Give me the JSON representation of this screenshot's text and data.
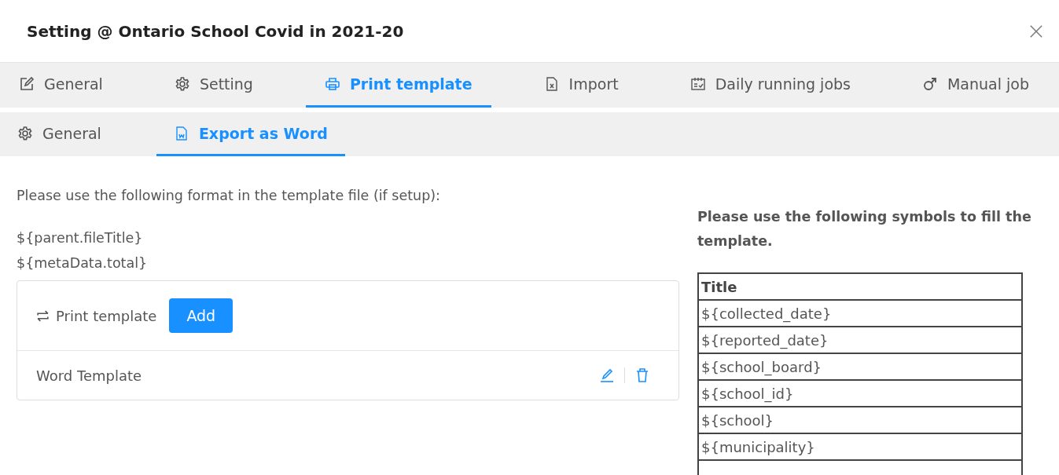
{
  "window": {
    "title": "Setting @ Ontario School Covid in 2021-20"
  },
  "tabs": [
    {
      "label": "General",
      "kind": "edit",
      "selected": false
    },
    {
      "label": "Setting",
      "kind": "gear",
      "selected": false
    },
    {
      "label": "Print template",
      "kind": "printer",
      "selected": true
    },
    {
      "label": "Import",
      "kind": "excel",
      "selected": false
    },
    {
      "label": "Daily running jobs",
      "kind": "calendar",
      "selected": false
    },
    {
      "label": "Manual job",
      "kind": "male",
      "selected": false
    }
  ],
  "sub_tabs": [
    {
      "label": "General",
      "kind": "gear",
      "selected": false
    },
    {
      "label": "Export as Word",
      "kind": "word",
      "selected": true
    }
  ],
  "instructions": {
    "intro": "Please use the following format in the template file (if setup):",
    "formats": [
      "${parent.fileTitle}",
      "${metaData.total}"
    ]
  },
  "template_card": {
    "label": "Print template",
    "add_button": "Add",
    "items": [
      {
        "name": "Word Template"
      }
    ]
  },
  "symbols": {
    "heading": "Please use the following symbols to fill the template.",
    "column": "Title",
    "rows": [
      "${collected_date}",
      "${reported_date}",
      "${school_board}",
      "${school_id}",
      "${school}",
      "${municipality}"
    ]
  }
}
